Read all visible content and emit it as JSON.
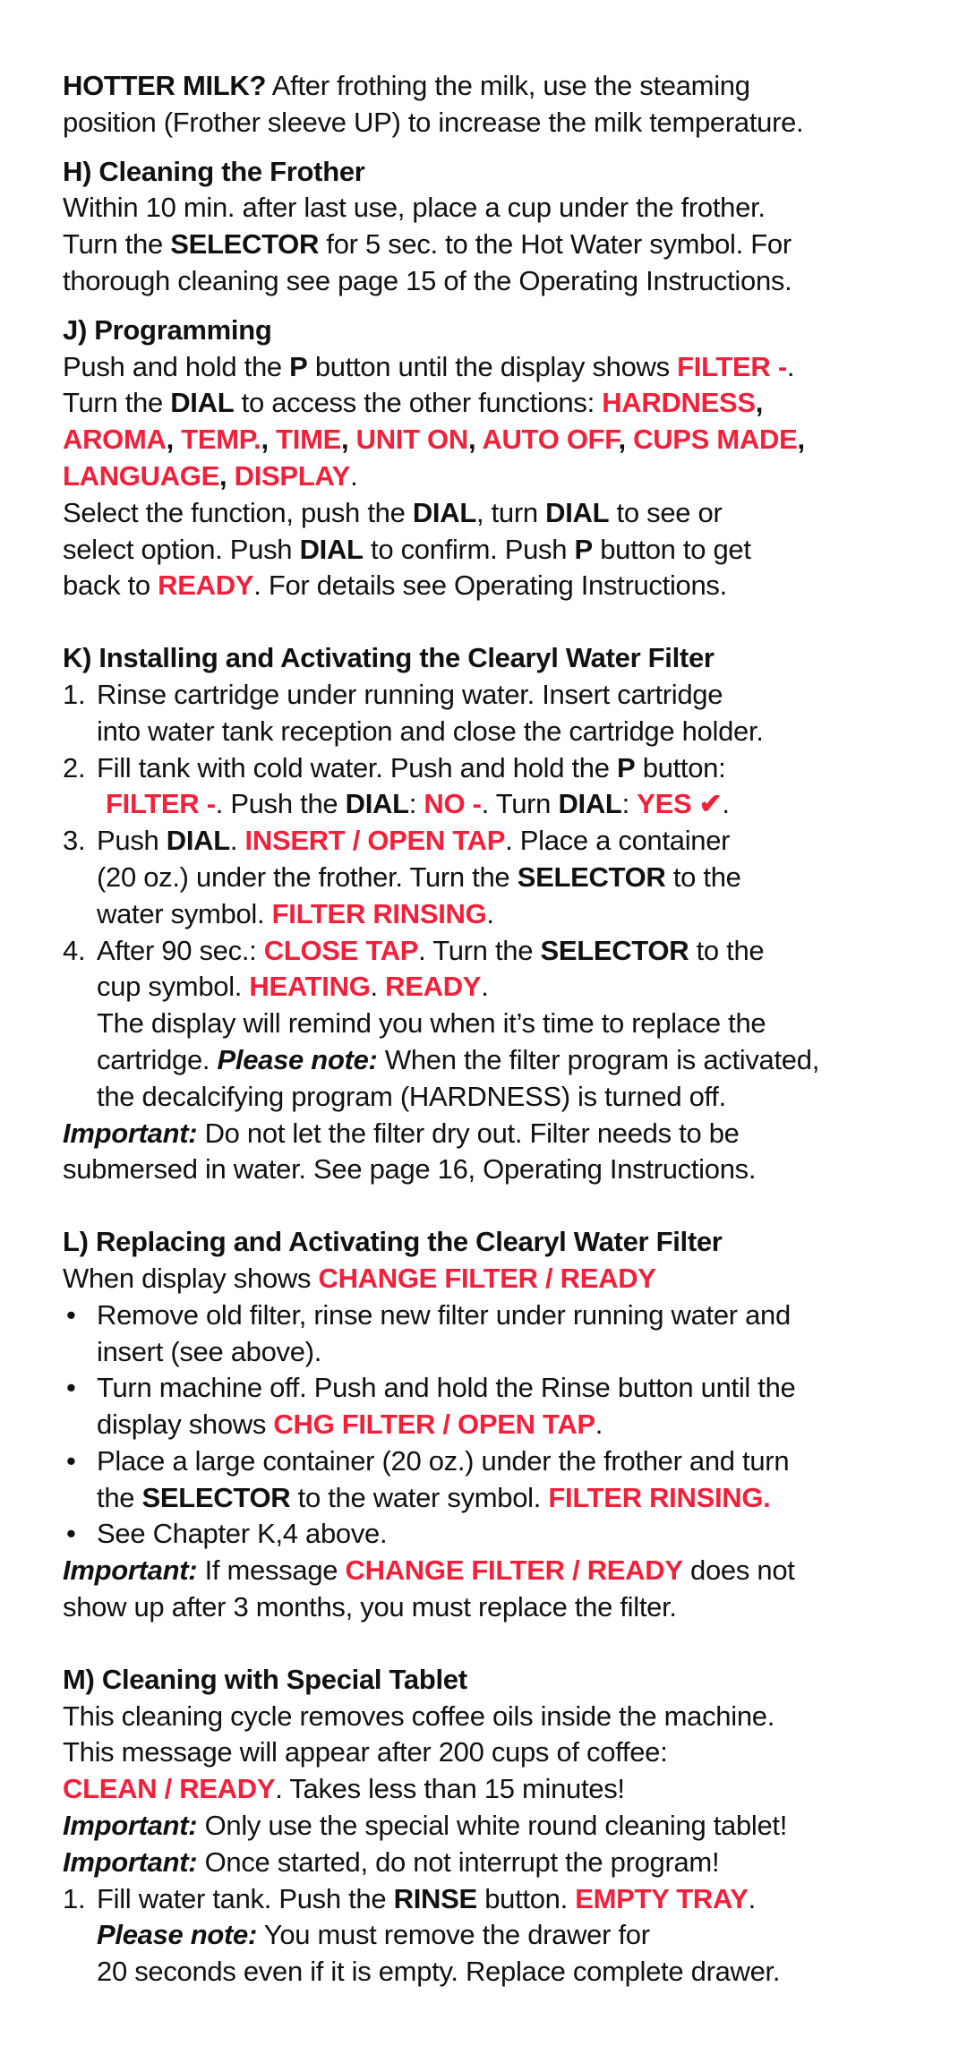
{
  "accent_color": "#f2203a",
  "sections": [
    {
      "id": "hotter-milk",
      "heading": null,
      "lines": [
        {
          "segs": [
            {
              "t": "HOTTER MILK?",
              "s": "b"
            },
            {
              "t": " After frothing the milk, use the steaming"
            }
          ]
        },
        {
          "segs": [
            {
              "t": "position (Frother sleeve UP) to increase the milk temperature."
            }
          ]
        }
      ]
    },
    {
      "id": "cleaning-frother",
      "heading": "H) Cleaning the Frother",
      "lines": [
        {
          "segs": [
            {
              "t": "Within 10 min. after last use, place a cup under the frother."
            }
          ]
        },
        {
          "segs": [
            {
              "t": "Turn the "
            },
            {
              "t": "SELECTOR",
              "s": "b"
            },
            {
              "t": " for 5 sec. to the Hot Water symbol. For"
            }
          ]
        },
        {
          "segs": [
            {
              "t": "thorough cleaning see page 15 of the Operating Instructions."
            }
          ]
        }
      ]
    },
    {
      "id": "programming",
      "heading": "J) Programming",
      "lines": [
        {
          "segs": [
            {
              "t": "Push and hold the "
            },
            {
              "t": "P",
              "s": "b"
            },
            {
              "t": " button until the display shows "
            },
            {
              "t": "FILTER -",
              "s": "r"
            },
            {
              "t": "."
            }
          ]
        },
        {
          "segs": [
            {
              "t": "Turn the "
            },
            {
              "t": "DIAL",
              "s": "b"
            },
            {
              "t": " to access the other functions: "
            },
            {
              "t": "HARDNESS",
              "s": "r"
            },
            {
              "t": ",",
              "s": "b"
            }
          ]
        },
        {
          "segs": [
            {
              "t": "AROMA",
              "s": "r"
            },
            {
              "t": ", ",
              "s": "b"
            },
            {
              "t": "TEMP.",
              "s": "r"
            },
            {
              "t": ", ",
              "s": "b"
            },
            {
              "t": "TIME",
              "s": "r"
            },
            {
              "t": ", ",
              "s": "b"
            },
            {
              "t": "UNIT ON",
              "s": "r"
            },
            {
              "t": ", ",
              "s": "b"
            },
            {
              "t": "AUTO OFF",
              "s": "r"
            },
            {
              "t": ", ",
              "s": "b"
            },
            {
              "t": "CUPS MADE",
              "s": "r"
            },
            {
              "t": ",",
              "s": "b"
            }
          ]
        },
        {
          "segs": [
            {
              "t": "LANGUAGE",
              "s": "r"
            },
            {
              "t": ", ",
              "s": "b"
            },
            {
              "t": "DISPLAY",
              "s": "r"
            },
            {
              "t": "."
            }
          ]
        },
        {
          "segs": [
            {
              "t": "Select the function, push the "
            },
            {
              "t": "DIAL",
              "s": "b"
            },
            {
              "t": ", turn "
            },
            {
              "t": "DIAL",
              "s": "b"
            },
            {
              "t": " to see or"
            }
          ]
        },
        {
          "segs": [
            {
              "t": "select option. Push "
            },
            {
              "t": "DIAL",
              "s": "b"
            },
            {
              "t": " to confirm. Push "
            },
            {
              "t": "P",
              "s": "b"
            },
            {
              "t": " button to get"
            }
          ]
        },
        {
          "segs": [
            {
              "t": "back to "
            },
            {
              "t": "READY",
              "s": "r"
            },
            {
              "t": ". For details see Operating Instructions."
            }
          ]
        }
      ]
    },
    {
      "id": "installing-filter",
      "heading": "K) Installing and Activating the Clearyl Water Filter",
      "lines": [
        {
          "num": "1.",
          "segs": [
            {
              "t": "Rinse cartridge under running water. Insert cartridge"
            }
          ]
        },
        {
          "ind": true,
          "segs": [
            {
              "t": "into water tank reception and close the cartridge holder."
            }
          ]
        },
        {
          "num": "2.",
          "segs": [
            {
              "t": "Fill tank with cold water. Push and hold the "
            },
            {
              "t": "P",
              "s": "b"
            },
            {
              "t": " button:"
            }
          ]
        },
        {
          "ind2": true,
          "segs": [
            {
              "t": "FILTER -",
              "s": "r"
            },
            {
              "t": ". Push the "
            },
            {
              "t": "DIAL",
              "s": "b"
            },
            {
              "t": ": "
            },
            {
              "t": "NO -",
              "s": "r"
            },
            {
              "t": ". Turn "
            },
            {
              "t": "DIAL",
              "s": "b"
            },
            {
              "t": ": "
            },
            {
              "t": "YES ✔",
              "s": "r"
            },
            {
              "t": "."
            }
          ]
        },
        {
          "num": "3.",
          "segs": [
            {
              "t": "Push "
            },
            {
              "t": "DIAL",
              "s": "b"
            },
            {
              "t": ". "
            },
            {
              "t": "INSERT / OPEN TAP",
              "s": "r"
            },
            {
              "t": ". Place a container"
            }
          ]
        },
        {
          "ind": true,
          "segs": [
            {
              "t": "(20 oz.) under the frother. Turn the "
            },
            {
              "t": "SELECTOR",
              "s": "b"
            },
            {
              "t": " to the"
            }
          ]
        },
        {
          "ind": true,
          "segs": [
            {
              "t": "water symbol. "
            },
            {
              "t": "FILTER RINSING",
              "s": "r"
            },
            {
              "t": "."
            }
          ]
        },
        {
          "num": "4.",
          "segs": [
            {
              "t": "After 90 sec.: "
            },
            {
              "t": "CLOSE TAP",
              "s": "r"
            },
            {
              "t": ". Turn the "
            },
            {
              "t": "SELECTOR",
              "s": "b"
            },
            {
              "t": " to the"
            }
          ]
        },
        {
          "ind": true,
          "segs": [
            {
              "t": "cup symbol. "
            },
            {
              "t": "HEATING",
              "s": "r"
            },
            {
              "t": ". "
            },
            {
              "t": "READY",
              "s": "r"
            },
            {
              "t": "."
            }
          ]
        },
        {
          "ind": true,
          "segs": [
            {
              "t": "The display will remind you when it’s time to replace the"
            }
          ]
        },
        {
          "ind": true,
          "segs": [
            {
              "t": "cartridge. "
            },
            {
              "t": "Please note:",
              "s": "bi"
            },
            {
              "t": " When the filter program is activated,"
            }
          ]
        },
        {
          "ind": true,
          "segs": [
            {
              "t": "the decalcifying program (HARDNESS) is turned off."
            }
          ]
        },
        {
          "segs": [
            {
              "t": "Important:",
              "s": "bi"
            },
            {
              "t": " Do not let the filter dry out. Filter needs to be"
            }
          ]
        },
        {
          "segs": [
            {
              "t": "submersed in water. See page 16, Operating Instructions."
            }
          ]
        }
      ]
    },
    {
      "id": "replacing-filter",
      "heading": "L) Replacing and Activating the Clearyl Water Filter",
      "lines": [
        {
          "segs": [
            {
              "t": "When display shows "
            },
            {
              "t": "CHANGE FILTER / READY",
              "s": "r"
            }
          ]
        },
        {
          "bullet": "•",
          "segs": [
            {
              "t": "Remove old filter, rinse new filter under running water and"
            }
          ]
        },
        {
          "ind": true,
          "segs": [
            {
              "t": "insert (see above)."
            }
          ]
        },
        {
          "bullet": "•",
          "segs": [
            {
              "t": "Turn machine off. Push and hold the Rinse button until the"
            }
          ]
        },
        {
          "ind": true,
          "segs": [
            {
              "t": "display shows "
            },
            {
              "t": "CHG FILTER / OPEN TAP",
              "s": "r"
            },
            {
              "t": "."
            }
          ]
        },
        {
          "bullet": "•",
          "segs": [
            {
              "t": "Place a large container (20 oz.) under the frother and turn"
            }
          ]
        },
        {
          "ind": true,
          "segs": [
            {
              "t": "the "
            },
            {
              "t": "SELECTOR",
              "s": "b"
            },
            {
              "t": " to the water symbol. "
            },
            {
              "t": "FILTER RINSING.",
              "s": "r"
            }
          ]
        },
        {
          "bullet": "•",
          "segs": [
            {
              "t": "See Chapter K,4 above."
            }
          ]
        },
        {
          "segs": [
            {
              "t": "Important:",
              "s": "bi"
            },
            {
              "t": " If message "
            },
            {
              "t": "CHANGE FILTER / READY",
              "s": "r"
            },
            {
              "t": " does not"
            }
          ]
        },
        {
          "segs": [
            {
              "t": "show up after 3 months, you must replace the filter."
            }
          ]
        }
      ]
    },
    {
      "id": "cleaning-tablet",
      "heading": "M) Cleaning with Special Tablet",
      "lines": [
        {
          "segs": [
            {
              "t": "This cleaning cycle removes coffee oils inside the machine."
            }
          ]
        },
        {
          "segs": [
            {
              "t": "This message will appear after 200 cups of coffee:"
            }
          ]
        },
        {
          "segs": [
            {
              "t": "CLEAN / READY",
              "s": "r"
            },
            {
              "t": ". Takes less than 15 minutes!"
            }
          ]
        },
        {
          "segs": [
            {
              "t": "Important:",
              "s": "bi"
            },
            {
              "t": " Only use the special white round cleaning tablet!"
            }
          ]
        },
        {
          "segs": [
            {
              "t": "Important:",
              "s": "bi"
            },
            {
              "t": " Once started, do not interrupt the program!"
            }
          ]
        },
        {
          "num": "1.",
          "segs": [
            {
              "t": "Fill water tank. Push the "
            },
            {
              "t": "RINSE",
              "s": "b"
            },
            {
              "t": " button. "
            },
            {
              "t": "EMPTY TRAY",
              "s": "r"
            },
            {
              "t": "."
            }
          ]
        },
        {
          "ind": true,
          "segs": [
            {
              "t": "Please note:",
              "s": "bi"
            },
            {
              "t": " You must remove the drawer for"
            }
          ]
        },
        {
          "ind": true,
          "segs": [
            {
              "t": "20 seconds even if it is empty. Replace complete drawer."
            }
          ]
        }
      ]
    }
  ],
  "section_gaps": [
    "none",
    "small",
    "small",
    "large",
    "large",
    "large"
  ]
}
